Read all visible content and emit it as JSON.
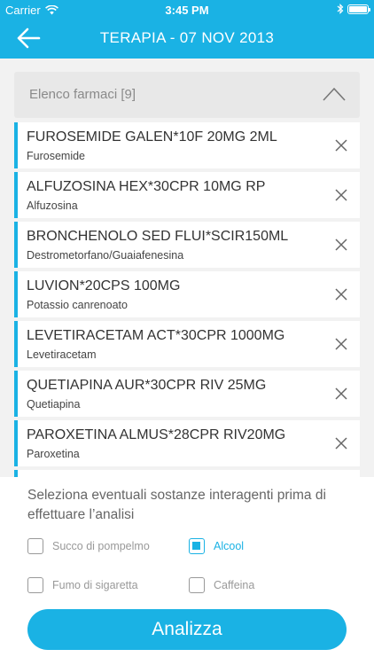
{
  "status_bar": {
    "carrier": "Carrier",
    "time": "3:45 PM"
  },
  "nav": {
    "title": "TERAPIA - 07 NOV 2013"
  },
  "drug_list": {
    "header": "Elenco farmaci [9]",
    "items": [
      {
        "name": "FUROSEMIDE GALEN*10F 20MG 2ML",
        "active": "Furosemide"
      },
      {
        "name": "ALFUZOSINA HEX*30CPR 10MG RP",
        "active": "Alfuzosina"
      },
      {
        "name": "BRONCHENOLO SED FLUI*SCIR150ML",
        "active": "Destrometorfano/Guaiafenesina"
      },
      {
        "name": "LUVION*20CPS 100MG",
        "active": "Potassio canrenoato"
      },
      {
        "name": "LEVETIRACETAM ACT*30CPR 1000MG",
        "active": "Levetiracetam"
      },
      {
        "name": "QUETIAPINA AUR*30CPR RIV 25MG",
        "active": "Quetiapina"
      },
      {
        "name": "PAROXETINA ALMUS*28CPR RIV20MG",
        "active": "Paroxetina"
      }
    ]
  },
  "interactions": {
    "instruction": "Seleziona eventuali sostanze interagenti prima di effettuare l’analisi",
    "options": [
      {
        "label": "Succo di pompelmo",
        "checked": false
      },
      {
        "label": "Alcool",
        "checked": true
      },
      {
        "label": "Fumo di sigaretta",
        "checked": false
      },
      {
        "label": "Caffeina",
        "checked": false
      }
    ]
  },
  "analyze_button": "Analizza",
  "colors": {
    "accent": "#1ab2e4",
    "background": "#f2f2f2"
  }
}
